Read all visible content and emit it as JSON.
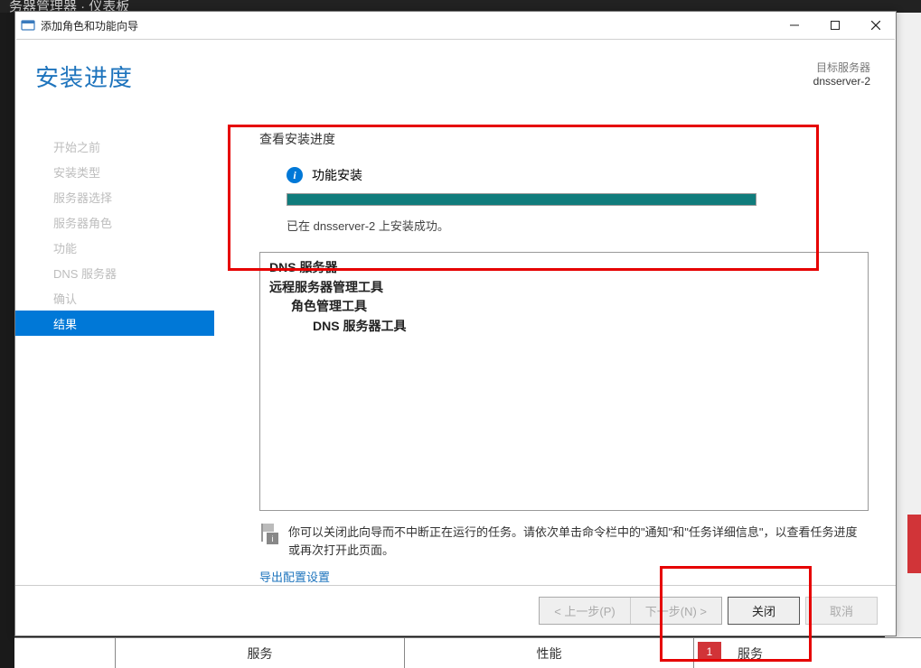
{
  "background": {
    "partial_title": "务器管理器 · 仪表板"
  },
  "titlebar": {
    "title": "添加角色和功能向导"
  },
  "header": {
    "page_title": "安装进度",
    "target_label": "目标服务器",
    "target_server": "dnsserver-2"
  },
  "steps": [
    {
      "label": "开始之前",
      "active": false
    },
    {
      "label": "安装类型",
      "active": false
    },
    {
      "label": "服务器选择",
      "active": false
    },
    {
      "label": "服务器角色",
      "active": false
    },
    {
      "label": "功能",
      "active": false
    },
    {
      "label": "DNS 服务器",
      "active": false
    },
    {
      "label": "确认",
      "active": false
    },
    {
      "label": "结果",
      "active": true
    }
  ],
  "content": {
    "section_label": "查看安装进度",
    "status_text": "功能安装",
    "progress_percent": 100,
    "success_msg": "已在 dnsserver-2 上安装成功。",
    "tree": [
      {
        "level": 0,
        "text": "DNS 服务器"
      },
      {
        "level": 0,
        "text": "远程服务器管理工具"
      },
      {
        "level": 1,
        "text": "角色管理工具"
      },
      {
        "level": 2,
        "text": "DNS 服务器工具"
      }
    ],
    "hint_text": "你可以关闭此向导而不中断正在运行的任务。请依次单击命令栏中的\"通知\"和\"任务详细信息\"，以查看任务进度或再次打开此页面。",
    "export_link": "导出配置设置"
  },
  "footer": {
    "prev": "< 上一步(P)",
    "next": "下一步(N) >",
    "close": "关闭",
    "cancel": "取消"
  },
  "bottom_strip": {
    "cell1": "服务",
    "cell2": "性能",
    "badge": "1",
    "cell3": "服务"
  }
}
